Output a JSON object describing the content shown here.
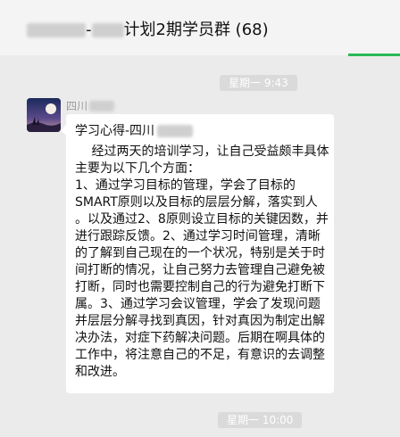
{
  "header": {
    "title_blurred_prefix": "",
    "title_separator": "-",
    "title_text": "计划2期学员群 (68)",
    "accent_color": "#2ab957"
  },
  "timestamps": {
    "top": "星期一 9:43",
    "bottom": "星期一 10:00"
  },
  "message": {
    "sender": "四川",
    "avatar_icon": "moon-night-scene-icon",
    "heading": "学习心得-四川",
    "lines": [
      "　 经过两天的培训学习，让自己受益颇丰具体",
      "主要为以下几个方面：",
      "1、通过学习目标的管理，学会了目标的",
      "SMART原则以及目标的层层分解，落实到人",
      "。以及通过2、8原则设立目标的关键因数，并",
      "进行跟踪反馈。2、通过学习时间管理，清晰",
      "的了解到自己现在的一个状况，特别是关于时",
      "间打断的情况，让自己努力去管理自己避免被",
      "打断，同时也需要控制自己的行为避免打断下",
      "属。3、通过学习会议管理，学会了发现问题",
      "并层层分解寻找到真因，针对真因为制定出解",
      "决办法，对症下药解决问题。后期在啊具体的",
      "工作中，将注意自己的不足，有意识的去调整",
      "和改进。"
    ]
  }
}
